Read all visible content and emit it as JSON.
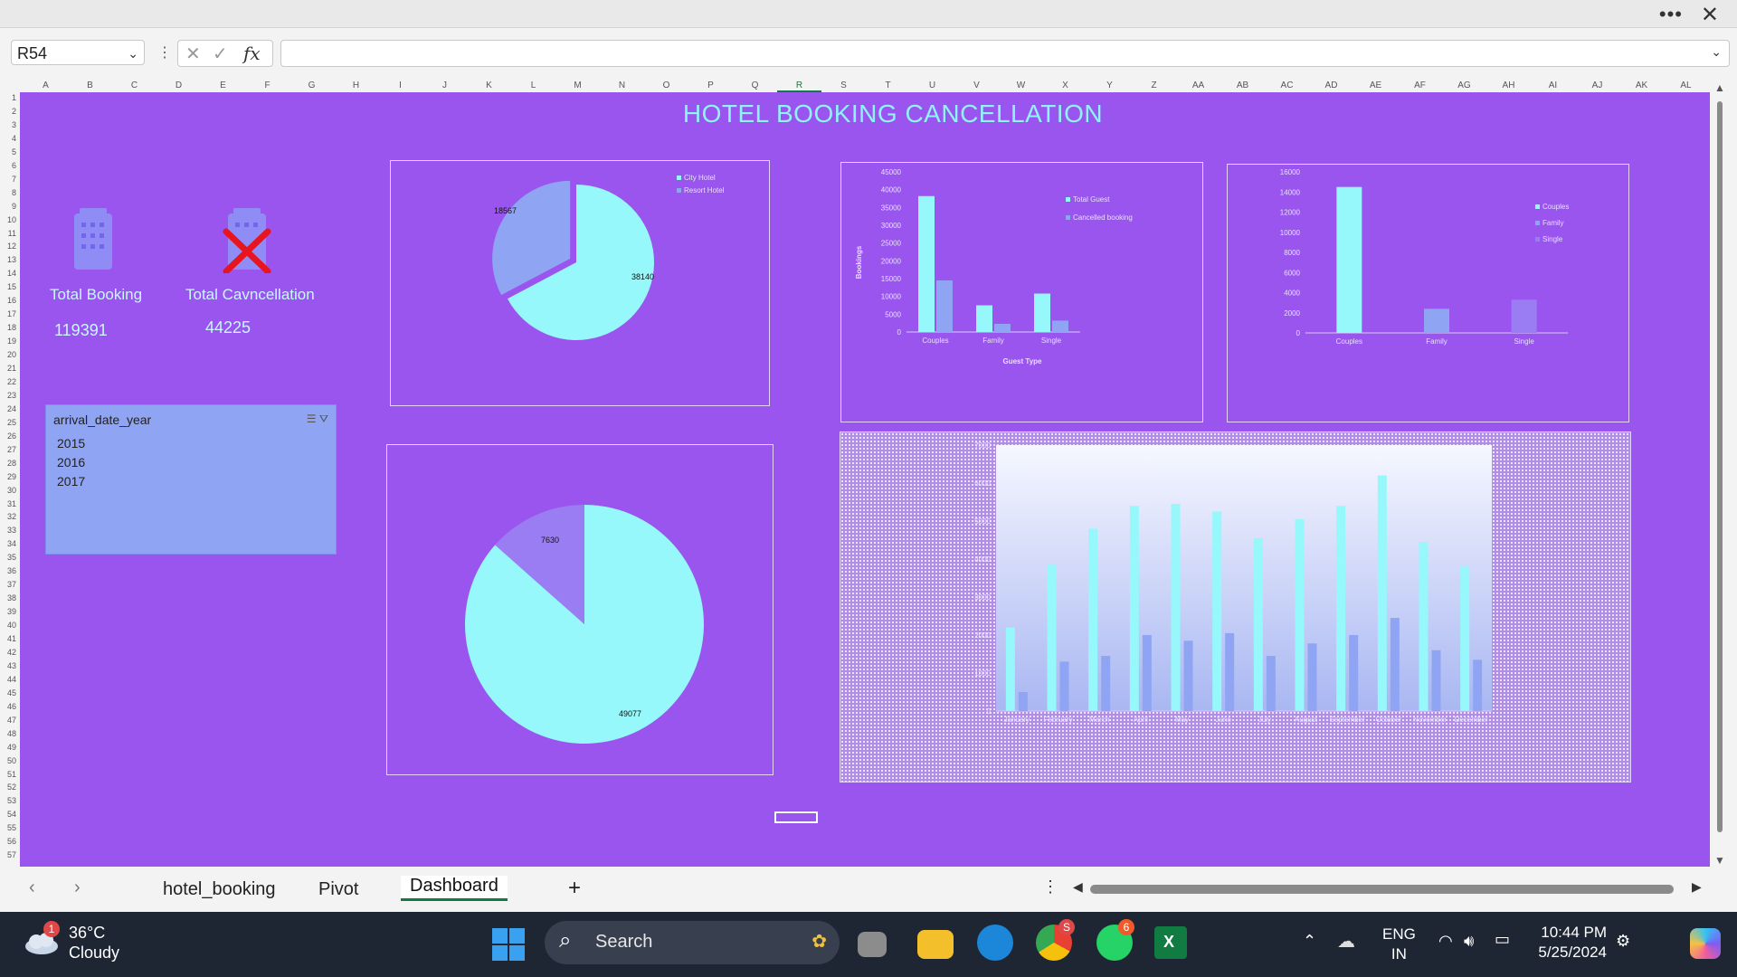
{
  "window": {
    "more_label": "•••",
    "close_label": "✕"
  },
  "formula_bar": {
    "name_box": "R54",
    "fx_label": "fx",
    "cancel_glyph": "✕",
    "enter_glyph": "✓",
    "formula": ""
  },
  "columns": [
    "A",
    "B",
    "C",
    "D",
    "E",
    "F",
    "G",
    "H",
    "I",
    "J",
    "K",
    "L",
    "M",
    "N",
    "O",
    "P",
    "Q",
    "R",
    "S",
    "T",
    "U",
    "V",
    "W",
    "X",
    "Y",
    "Z",
    "AA",
    "AB",
    "AC",
    "AD",
    "AE",
    "AF",
    "AG",
    "AH",
    "AI",
    "AJ",
    "AK",
    "AL"
  ],
  "selected_column": "R",
  "rows": [
    "1",
    "2",
    "3",
    "4",
    "5",
    "6",
    "7",
    "8",
    "9",
    "10",
    "11",
    "12",
    "13",
    "14",
    "15",
    "16",
    "17",
    "18",
    "19",
    "20",
    "21",
    "22",
    "23",
    "24",
    "25",
    "26",
    "27",
    "28",
    "29",
    "30",
    "31",
    "32",
    "33",
    "34",
    "35",
    "36",
    "37",
    "38",
    "39",
    "40",
    "41",
    "42",
    "43",
    "44",
    "45",
    "46",
    "47",
    "48",
    "49",
    "50",
    "51",
    "52",
    "53",
    "54",
    "55",
    "56",
    "57"
  ],
  "dashboard": {
    "title": "HOTEL  BOOKING CANCELLATION",
    "kpis": [
      {
        "label": "Total Booking",
        "value": "119391",
        "icon": "hotel-building-icon"
      },
      {
        "label": "Total Cavncellation",
        "value": "44225",
        "icon": "hotel-cancel-icon"
      }
    ],
    "slicer": {
      "title": "arrival_date_year",
      "items": [
        "2015",
        "2016",
        "2017"
      ]
    }
  },
  "colors": {
    "sheet_bg": "#9a55ee",
    "cyan": "#96f8fa",
    "blue": "#8fa4f3",
    "periwinkle": "#9a7df2"
  },
  "chart_data": [
    {
      "type": "pie",
      "legend": [
        "City Hotel",
        "Resort Hotel"
      ],
      "values": [
        38140,
        18567
      ],
      "labels": [
        "38140",
        "18567"
      ]
    },
    {
      "type": "pie",
      "legend": [],
      "values": [
        49077,
        7630
      ],
      "labels": [
        "49077",
        "7630"
      ]
    },
    {
      "type": "bar",
      "categories": [
        "Couples",
        "Family",
        "Single"
      ],
      "series": [
        {
          "name": "Total Guest",
          "values": [
            38200,
            7500,
            10800
          ]
        },
        {
          "name": "Cancelled booking",
          "values": [
            14500,
            2300,
            3200
          ]
        }
      ],
      "xlabel": "Guest Type",
      "ylabel": "Bookings",
      "yticks": [
        "0",
        "5000",
        "10000",
        "15000",
        "20000",
        "25000",
        "30000",
        "35000",
        "40000",
        "45000"
      ],
      "ylim": [
        0,
        45000
      ]
    },
    {
      "type": "bar",
      "categories": [
        "Couples",
        "Family",
        "Single"
      ],
      "legend": [
        "Couples",
        "Family",
        "Single"
      ],
      "values": [
        14500,
        2400,
        3300
      ],
      "yticks": [
        "0",
        "2000",
        "4000",
        "6000",
        "8000",
        "10000",
        "12000",
        "14000",
        "16000"
      ],
      "ylim": [
        0,
        16000
      ]
    },
    {
      "type": "bar",
      "categories": [
        "January",
        "February",
        "March",
        "April",
        "May",
        "June",
        "July",
        "August",
        "September",
        "October",
        "November",
        "December"
      ],
      "series": [
        {
          "name": "",
          "values": [
            2200,
            3850,
            4800,
            5400,
            5450,
            5250,
            4550,
            5050,
            5400,
            6200,
            4450,
            3800
          ]
        },
        {
          "name": "",
          "values": [
            500,
            1300,
            1450,
            2000,
            1850,
            2050,
            1450,
            1780,
            2000,
            2450,
            1600,
            1350
          ]
        }
      ],
      "yticks": [
        "0",
        "1000",
        "2000",
        "3000",
        "4000",
        "5000",
        "6000",
        "7000"
      ],
      "ylim": [
        0,
        7000
      ]
    }
  ],
  "sheet_tabs": [
    "hotel_booking",
    "Pivot",
    "Dashboard"
  ],
  "active_tab": "Dashboard",
  "add_sheet": "+",
  "taskbar": {
    "weather_temp": "36°C",
    "weather_desc": "Cloudy",
    "weather_badge": "1",
    "search_label": "Search",
    "lang1": "ENG",
    "lang2": "IN",
    "time": "10:44 PM",
    "date": "5/25/2024",
    "chrome_badge": "S",
    "whatsapp_badge": "6"
  }
}
